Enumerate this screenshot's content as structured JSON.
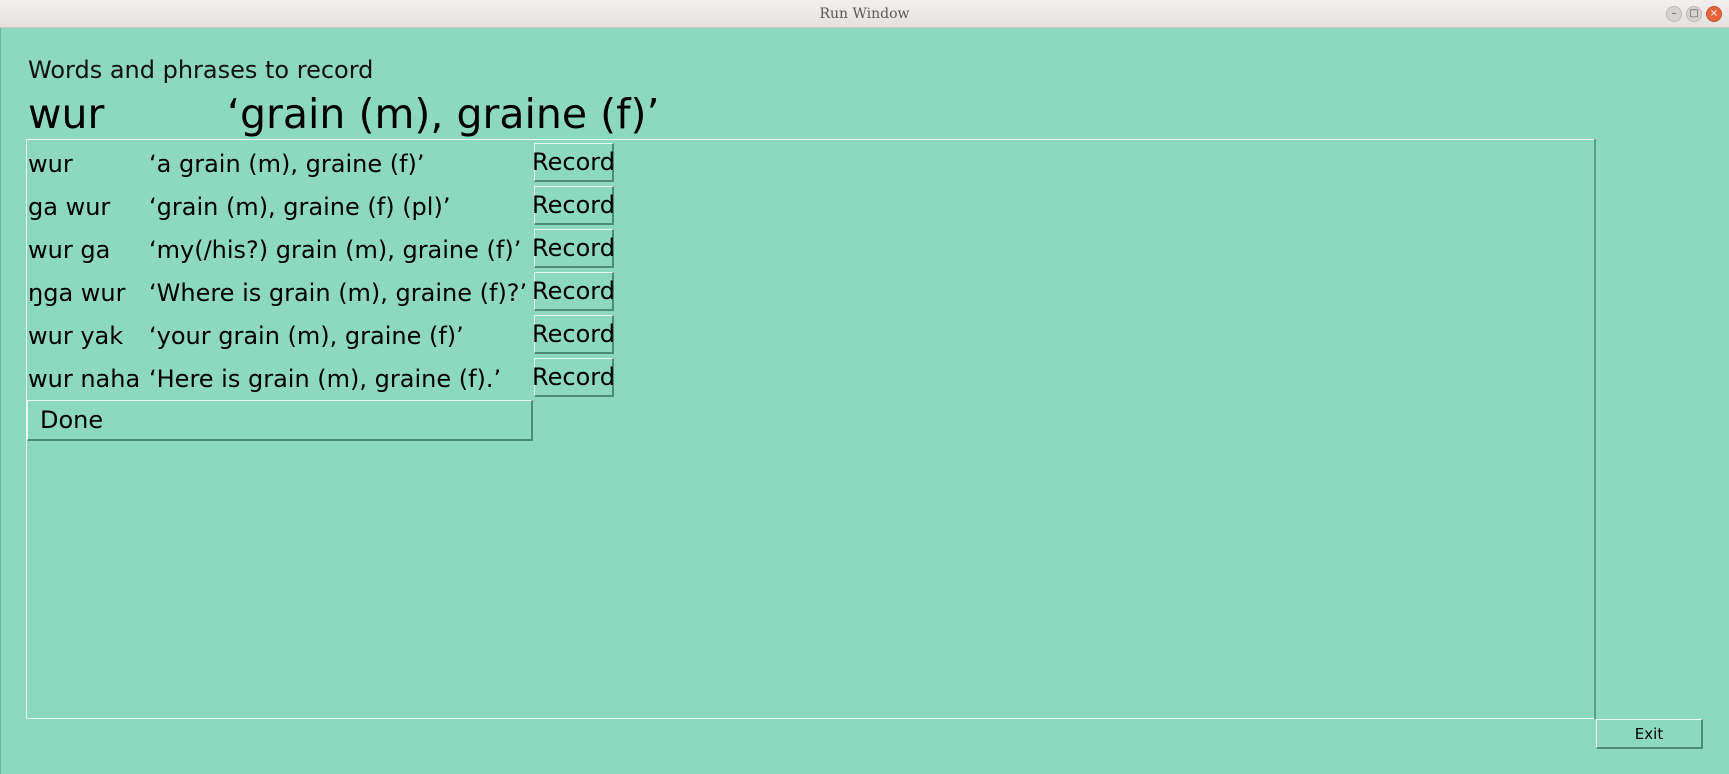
{
  "window": {
    "title": "Run Window",
    "controls": {
      "minimize": "–",
      "maximize": "□",
      "close": "×"
    }
  },
  "main": {
    "heading": "Words and phrases to record",
    "current_form": "wur",
    "current_gloss": "‘grain (m), graine (f)’",
    "rows": [
      {
        "form": "wur",
        "gloss": "‘a grain (m), graine (f)’",
        "button": "Record"
      },
      {
        "form": "ga wur",
        "gloss": "‘grain (m), graine (f) (pl)’",
        "button": "Record"
      },
      {
        "form": "wur ga",
        "gloss": "‘my(/his?) grain (m), graine (f)’",
        "button": "Record"
      },
      {
        "form": "ŋga wur",
        "gloss": "‘Where is grain (m), graine (f)?’",
        "button": "Record"
      },
      {
        "form": "wur yak",
        "gloss": "‘your grain (m), graine (f)’",
        "button": "Record"
      },
      {
        "form": "wur naha",
        "gloss": "‘Here is grain (m), graine (f).’",
        "button": "Record"
      }
    ],
    "done_label": "Done"
  },
  "footer": {
    "exit_label": "Exit"
  }
}
